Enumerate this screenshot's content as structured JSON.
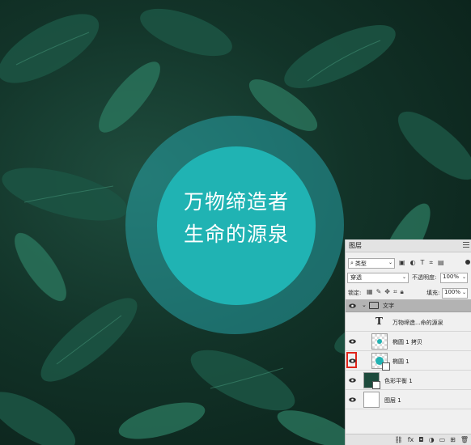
{
  "canvas": {
    "headline_line1": "万物缔造者",
    "headline_line2": "生命的源泉",
    "circle_color": "#20b3b3"
  },
  "layers_panel": {
    "tab_label": "图层",
    "filter": {
      "kind_label": "类型",
      "icon": "search-icon"
    },
    "blend_mode": "穿透",
    "opacity_label": "不透明度:",
    "opacity_value": "100%",
    "lock_label": "锁定:",
    "fill_label": "填充:",
    "fill_value": "100%",
    "layers": [
      {
        "name": "文字",
        "type": "group",
        "visible": true
      },
      {
        "name": "万物缔造...命的源泉",
        "type": "text",
        "visible": false
      },
      {
        "name": "椭圆 1 拷贝",
        "type": "shape",
        "visible": true
      },
      {
        "name": "椭圆 1",
        "type": "shape",
        "visible": true,
        "highlighted": true
      },
      {
        "name": "色彩平衡 1",
        "type": "adjustment",
        "visible": true
      },
      {
        "name": "图层 1",
        "type": "pixel",
        "visible": true
      }
    ],
    "accent_highlight": "#e0241a"
  }
}
